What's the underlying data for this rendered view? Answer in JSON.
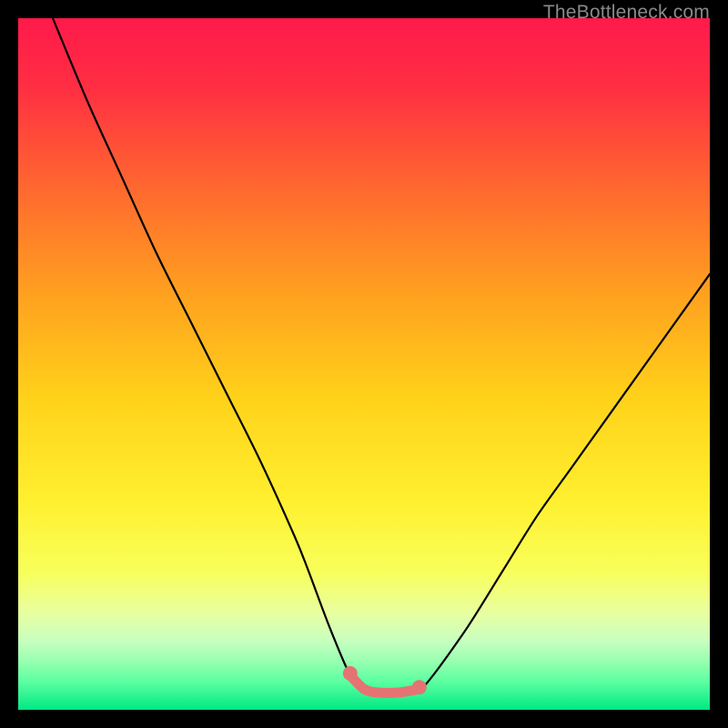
{
  "watermark": "TheBottleneck.com",
  "gradient": {
    "stops": [
      {
        "offset": 0.0,
        "color": "#ff1a4b"
      },
      {
        "offset": 0.1,
        "color": "#ff2e42"
      },
      {
        "offset": 0.25,
        "color": "#ff6a2f"
      },
      {
        "offset": 0.4,
        "color": "#ffa11f"
      },
      {
        "offset": 0.55,
        "color": "#ffd21a"
      },
      {
        "offset": 0.7,
        "color": "#fff030"
      },
      {
        "offset": 0.8,
        "color": "#f8ff5a"
      },
      {
        "offset": 0.86,
        "color": "#e8ffa0"
      },
      {
        "offset": 0.9,
        "color": "#c8ffc0"
      },
      {
        "offset": 0.93,
        "color": "#97ffb0"
      },
      {
        "offset": 0.96,
        "color": "#5affa0"
      },
      {
        "offset": 1.0,
        "color": "#00e884"
      }
    ]
  },
  "chart_data": {
    "type": "line",
    "title": "",
    "xlabel": "",
    "ylabel": "",
    "xlim": [
      0,
      100
    ],
    "ylim": [
      0,
      100
    ],
    "series": [
      {
        "name": "bottleneck-curve",
        "x": [
          5,
          10,
          15,
          20,
          25,
          30,
          35,
          40,
          42,
          45,
          48,
          50,
          52,
          55,
          58,
          60,
          65,
          70,
          75,
          80,
          85,
          90,
          95,
          100
        ],
        "y": [
          100,
          88,
          77,
          66,
          56,
          46,
          36,
          25,
          20,
          12,
          5,
          3,
          2.5,
          2.5,
          3,
          5,
          12,
          20,
          28,
          35,
          42,
          49,
          56,
          63
        ]
      }
    ],
    "annotations": [
      {
        "name": "flat-segment",
        "x": [
          48,
          50,
          52,
          55,
          58
        ],
        "y": [
          5,
          3,
          2.5,
          2.5,
          3
        ],
        "style": "thick-pink"
      }
    ]
  }
}
